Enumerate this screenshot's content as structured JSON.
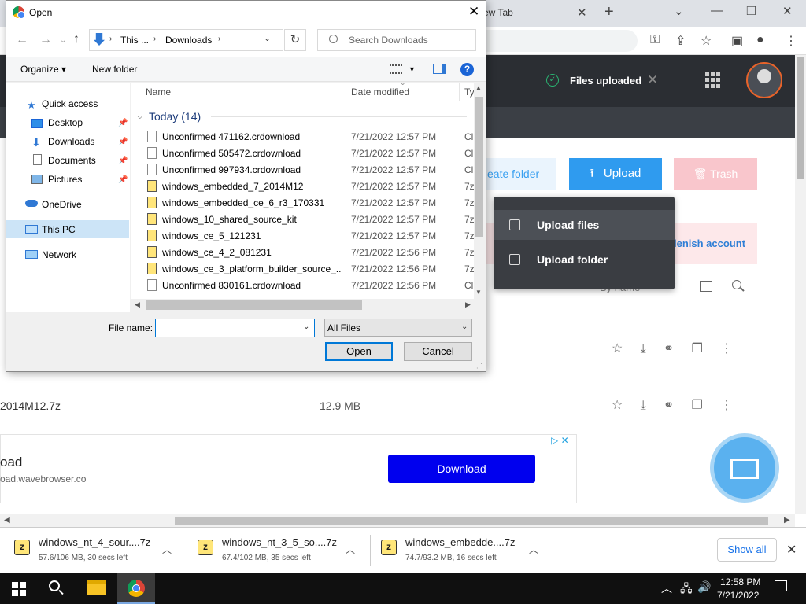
{
  "browser": {
    "tab_title": "ew Tab",
    "tab_close": "✕",
    "new_tab": "+",
    "minimize": "⌄",
    "min_btn": "—",
    "restore_btn": "❐",
    "close_btn": "✕"
  },
  "page": {
    "files_uploaded": "Files uploaded",
    "create_folder": "eate folder",
    "upload": "Upload",
    "trash": "Trash",
    "replenish": "lenish account",
    "sort_by": "By name",
    "upload_menu": [
      "Upload files",
      "Upload folder"
    ],
    "row": {
      "name": "2014M12.7z",
      "size": "12.9 MB"
    },
    "ad": {
      "title": "oad",
      "url": "oad.wavebrowser.co",
      "button": "Download",
      "adchoice": "▷ ✕"
    }
  },
  "downloads": [
    {
      "name": "windows_nt_4_sour....7z",
      "status": "57.6/106 MB, 30 secs left"
    },
    {
      "name": "windows_nt_3_5_so....7z",
      "status": "67.4/102 MB, 35 secs left"
    },
    {
      "name": "windows_embedde....7z",
      "status": "74.7/93.2 MB, 16 secs left"
    }
  ],
  "show_all": "Show all",
  "taskbar": {
    "time": "12:58 PM",
    "date": "7/21/2022"
  },
  "dialog": {
    "title": "Open",
    "breadcrumb": [
      "This ...",
      "Downloads"
    ],
    "search_placeholder": "Search Downloads",
    "organize": "Organize ▾",
    "new_folder": "New folder",
    "help": "?",
    "nav": {
      "quick_access": "Quick access",
      "desktop": "Desktop",
      "downloads": "Downloads",
      "documents": "Documents",
      "pictures": "Pictures",
      "onedrive": "OneDrive",
      "this_pc": "This PC",
      "network": "Network"
    },
    "columns": {
      "name": "Name",
      "date": "Date modified",
      "type": "Ty"
    },
    "group": "Today (14)",
    "files": [
      {
        "name": "Unconfirmed 471162.crdownload",
        "date": "7/21/2022 12:57 PM",
        "type": "Cl",
        "zip": false
      },
      {
        "name": "Unconfirmed 505472.crdownload",
        "date": "7/21/2022 12:57 PM",
        "type": "Cl",
        "zip": false
      },
      {
        "name": "Unconfirmed 997934.crdownload",
        "date": "7/21/2022 12:57 PM",
        "type": "Cl",
        "zip": false
      },
      {
        "name": "windows_embedded_7_2014M12",
        "date": "7/21/2022 12:57 PM",
        "type": "7z",
        "zip": true
      },
      {
        "name": "windows_embedded_ce_6_r3_170331",
        "date": "7/21/2022 12:57 PM",
        "type": "7z",
        "zip": true
      },
      {
        "name": "windows_10_shared_source_kit",
        "date": "7/21/2022 12:57 PM",
        "type": "7z",
        "zip": true
      },
      {
        "name": "windows_ce_5_121231",
        "date": "7/21/2022 12:57 PM",
        "type": "7z",
        "zip": true
      },
      {
        "name": "windows_ce_4_2_081231",
        "date": "7/21/2022 12:56 PM",
        "type": "7z",
        "zip": true
      },
      {
        "name": "windows_ce_3_platform_builder_source_...",
        "date": "7/21/2022 12:56 PM",
        "type": "7z",
        "zip": true
      },
      {
        "name": "Unconfirmed 830161.crdownload",
        "date": "7/21/2022 12:56 PM",
        "type": "Cl",
        "zip": false
      }
    ],
    "file_name_label": "File name:",
    "file_name_value": "",
    "file_type": "All Files",
    "open": "Open",
    "cancel": "Cancel"
  }
}
